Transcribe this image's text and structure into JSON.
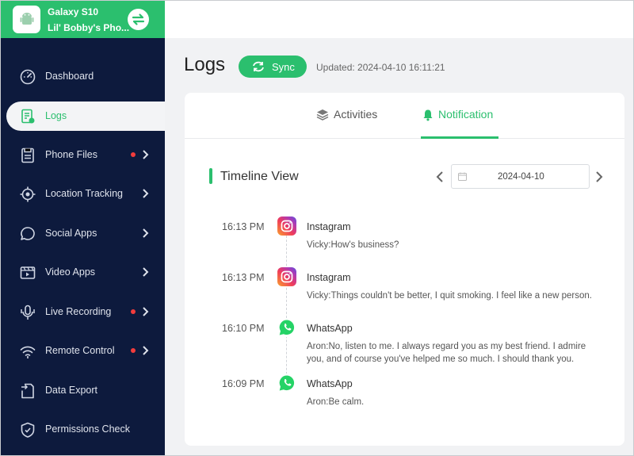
{
  "device": {
    "name": "Galaxy S10",
    "owner": "Lil' Bobby's Pho..."
  },
  "sidebar": {
    "items": [
      {
        "label": "Dashboard",
        "icon": "gauge-icon"
      },
      {
        "label": "Logs",
        "icon": "document-icon",
        "active": true
      },
      {
        "label": "Phone Files",
        "icon": "file-icon",
        "new": true,
        "expandable": true
      },
      {
        "label": "Location Tracking",
        "icon": "target-icon",
        "expandable": true
      },
      {
        "label": "Social Apps",
        "icon": "chat-bubble-icon",
        "expandable": true
      },
      {
        "label": "Video Apps",
        "icon": "video-icon",
        "expandable": true
      },
      {
        "label": "Live Recording",
        "icon": "microphone-icon",
        "new": true,
        "expandable": true
      },
      {
        "label": "Remote Control",
        "icon": "wifi-icon",
        "new": true,
        "expandable": true
      },
      {
        "label": "Data Export",
        "icon": "export-icon"
      },
      {
        "label": "Permissions Check",
        "icon": "shield-icon"
      }
    ]
  },
  "header": {
    "title": "Logs",
    "sync_label": "Sync",
    "updated": "Updated: 2024-04-10 16:11:21"
  },
  "tabs": [
    {
      "label": "Activities",
      "icon": "layers-icon"
    },
    {
      "label": "Notification",
      "icon": "bell-icon",
      "active": true
    }
  ],
  "timeline": {
    "title": "Timeline View",
    "date": "2024-04-10",
    "entries": [
      {
        "time": "16:13 PM",
        "app": "Instagram",
        "icon": "instagram-icon",
        "message": "Vicky:How's business?"
      },
      {
        "time": "16:13 PM",
        "app": "Instagram",
        "icon": "instagram-icon",
        "message": "Vicky:Things couldn't be better, I quit smoking. I feel like a new person."
      },
      {
        "time": "16:10 PM",
        "app": "WhatsApp",
        "icon": "whatsapp-icon",
        "message": "Aron:No, listen to me. I always regard you as my best friend. I admire you, and of course you've helped me so much. I should thank you."
      },
      {
        "time": "16:09 PM",
        "app": "WhatsApp",
        "icon": "whatsapp-icon",
        "message": "Aron:Be calm."
      }
    ]
  },
  "colors": {
    "accent": "#2bbf6e",
    "sidebar": "#0d1a3d",
    "badge": "#f23c3c"
  }
}
